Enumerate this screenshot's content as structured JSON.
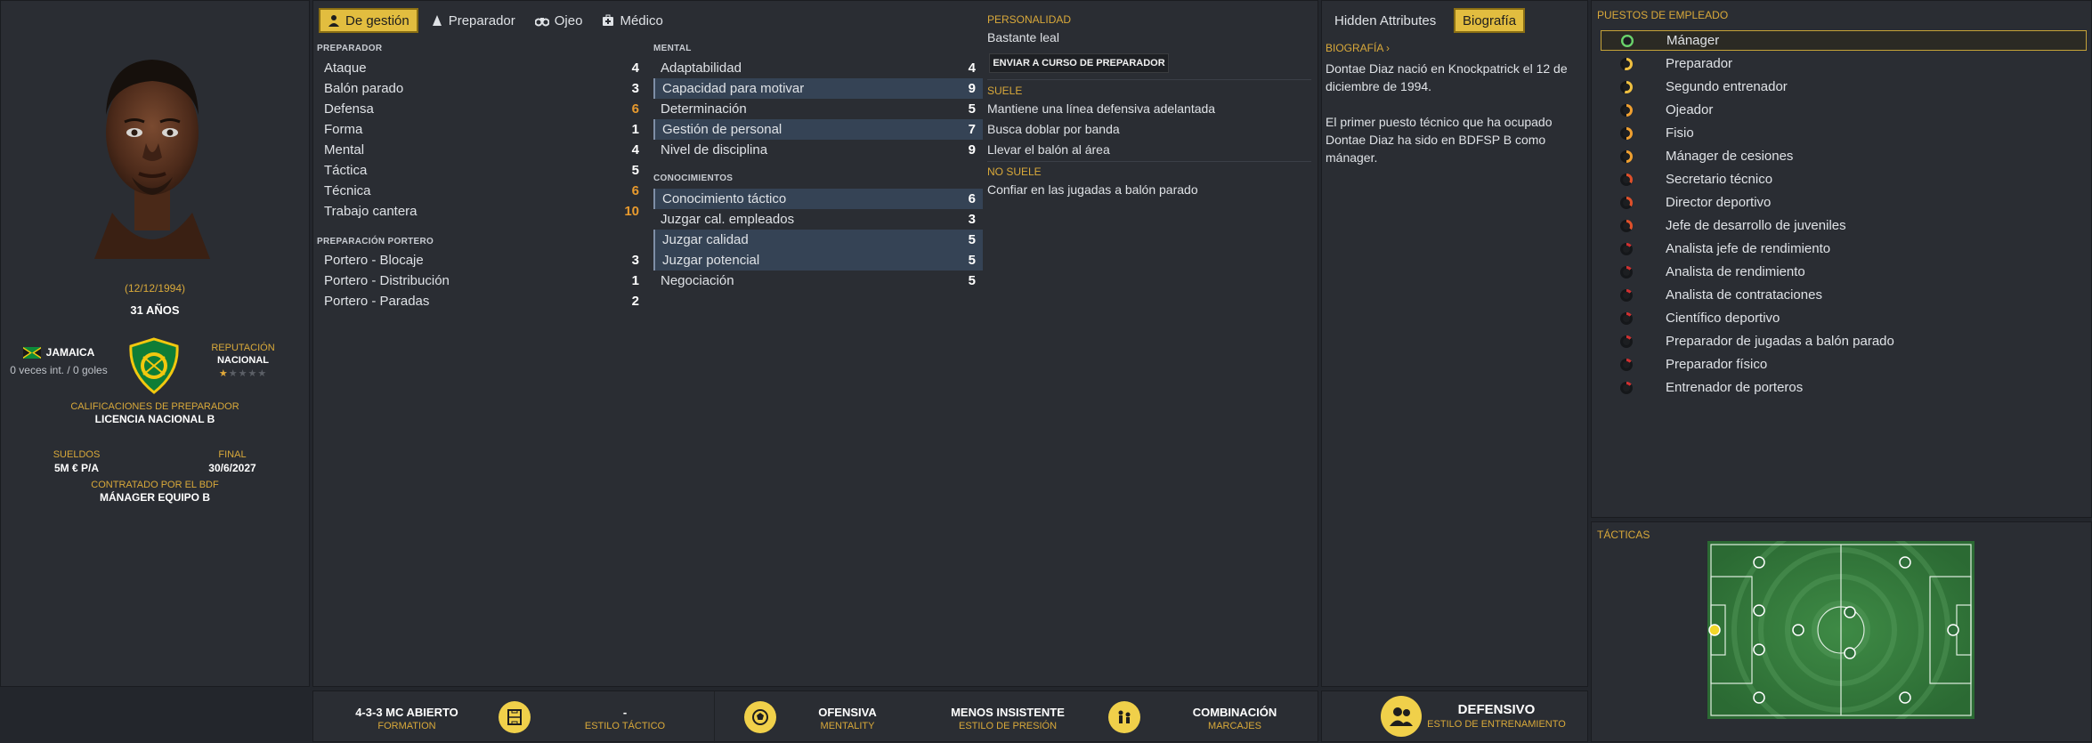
{
  "profile": {
    "dob": "(12/12/1994)",
    "age": "31 AÑOS",
    "country": "JAMAICA",
    "caps": "0 veces int. / 0 goles",
    "reputation_label": "REPUTACIÓN",
    "reputation_value": "NACIONAL",
    "reputation_stars": 0.5,
    "coaching_label": "CALIFICACIONES DE PREPARADOR",
    "coaching_value": "LICENCIA NACIONAL B",
    "wage_label": "SUELDOS",
    "wage_value": "5M € P/A",
    "end_label": "FINAL",
    "end_value": "30/6/2027",
    "contract_label": "CONTRATADO POR EL BDF",
    "contract_value": "MÁNAGER EQUIPO B"
  },
  "tabs": [
    {
      "label": "De gestión",
      "icon": "manager-icon",
      "active": true
    },
    {
      "label": "Preparador",
      "icon": "cone-icon",
      "active": false
    },
    {
      "label": "Ojeo",
      "icon": "binoculars-icon",
      "active": false
    },
    {
      "label": "Médico",
      "icon": "medkit-icon",
      "active": false
    }
  ],
  "preparador": {
    "title": "PREPARADOR",
    "rows": [
      {
        "label": "Ataque",
        "value": "4",
        "color": "white"
      },
      {
        "label": "Balón parado",
        "value": "3",
        "color": "white"
      },
      {
        "label": "Defensa",
        "value": "6",
        "color": "orange"
      },
      {
        "label": "Forma",
        "value": "1",
        "color": "white"
      },
      {
        "label": "Mental",
        "value": "4",
        "color": "white"
      },
      {
        "label": "Táctica",
        "value": "5",
        "color": "white"
      },
      {
        "label": "Técnica",
        "value": "6",
        "color": "orange"
      },
      {
        "label": "Trabajo cantera",
        "value": "10",
        "color": "orange"
      }
    ]
  },
  "portero": {
    "title": "PREPARACIÓN PORTERO",
    "rows": [
      {
        "label": "Portero - Blocaje",
        "value": "3",
        "color": "white"
      },
      {
        "label": "Portero - Distribución",
        "value": "1",
        "color": "white"
      },
      {
        "label": "Portero - Paradas",
        "value": "2",
        "color": "white"
      }
    ]
  },
  "mental": {
    "title": "MENTAL",
    "rows": [
      {
        "label": "Adaptabilidad",
        "value": "4",
        "hl": false
      },
      {
        "label": "Capacidad para motivar",
        "value": "9",
        "hl": true
      },
      {
        "label": "Determinación",
        "value": "5",
        "hl": false
      },
      {
        "label": "Gestión de personal",
        "value": "7",
        "hl": true
      },
      {
        "label": "Nivel de disciplina",
        "value": "9",
        "hl": false
      }
    ]
  },
  "conocimientos": {
    "title": "CONOCIMIENTOS",
    "rows": [
      {
        "label": "Conocimiento táctico",
        "value": "6",
        "hl": true
      },
      {
        "label": "Juzgar cal. empleados",
        "value": "3",
        "hl": false
      },
      {
        "label": "Juzgar calidad",
        "value": "5",
        "hl": true
      },
      {
        "label": "Juzgar potencial",
        "value": "5",
        "hl": true
      },
      {
        "label": "Negociación",
        "value": "5",
        "hl": false
      }
    ]
  },
  "personality": {
    "title": "PERSONALIDAD",
    "value": "Bastante leal",
    "course_button": "ENVIAR A CURSO DE PREPARADOR",
    "suele_title": "SUELE",
    "suele": [
      "Mantiene una línea defensiva adelantada",
      "Busca doblar por banda",
      "Llevar el balón al área"
    ],
    "no_suele_title": "NO SUELE",
    "no_suele": [
      "Confiar en las jugadas a balón parado"
    ]
  },
  "bio": {
    "tab_hidden": "Hidden Attributes",
    "tab_bio": "Biografía",
    "section": "BIOGRAFÍA ›",
    "p1": "Dontae Diaz nació en Knockpatrick el 12 de diciembre de 1994.",
    "p2": "El primer puesto técnico que ha ocupado Dontae Diaz ha sido en BDFSP B como mánager."
  },
  "roles": {
    "title": "PUESTOS DE EMPLEADO",
    "items": [
      {
        "label": "Mánager",
        "level": 1.0,
        "color": "#6ad36a",
        "active": true
      },
      {
        "label": "Preparador",
        "level": 0.55,
        "color": "#f0c040",
        "active": false
      },
      {
        "label": "Segundo entrenador",
        "level": 0.55,
        "color": "#f0c040",
        "active": false
      },
      {
        "label": "Ojeador",
        "level": 0.5,
        "color": "#f0a030",
        "active": false
      },
      {
        "label": "Fisio",
        "level": 0.5,
        "color": "#f0a030",
        "active": false
      },
      {
        "label": "Mánager de cesiones",
        "level": 0.5,
        "color": "#f0a030",
        "active": false
      },
      {
        "label": "Secretario técnico",
        "level": 0.35,
        "color": "#e0502a",
        "active": false
      },
      {
        "label": "Director deportivo",
        "level": 0.35,
        "color": "#e0502a",
        "active": false
      },
      {
        "label": "Jefe de desarrollo de juveniles",
        "level": 0.35,
        "color": "#e0502a",
        "active": false
      },
      {
        "label": "Analista jefe de rendimiento",
        "level": 0.15,
        "color": "#d03030",
        "active": false
      },
      {
        "label": "Analista de rendimiento",
        "level": 0.15,
        "color": "#d03030",
        "active": false
      },
      {
        "label": "Analista de contrataciones",
        "level": 0.15,
        "color": "#d03030",
        "active": false
      },
      {
        "label": "Científico deportivo",
        "level": 0.15,
        "color": "#d03030",
        "active": false
      },
      {
        "label": "Preparador de jugadas a balón parado",
        "level": 0.15,
        "color": "#d03030",
        "active": false
      },
      {
        "label": "Preparador físico",
        "level": 0.15,
        "color": "#d03030",
        "active": false
      },
      {
        "label": "Entrenador de porteros",
        "level": 0.15,
        "color": "#d03030",
        "active": false
      }
    ]
  },
  "tactics": {
    "title": "TÁCTICAS"
  },
  "bottom": {
    "formation": "4-3-3 MC ABIERTO",
    "formation_label": "FORMATION",
    "style_value": "-",
    "style_label": "ESTILO TÁCTICO",
    "mentality": "OFENSIVA",
    "mentality_label": "MENTALITY",
    "press": "MENOS INSISTENTE",
    "press_label": "ESTILO DE PRESIÓN",
    "marking": "COMBINACIÓN",
    "marking_label": "MARCAJES",
    "training": "DEFENSIVO",
    "training_label": "ESTILO DE ENTRENAMIENTO"
  }
}
